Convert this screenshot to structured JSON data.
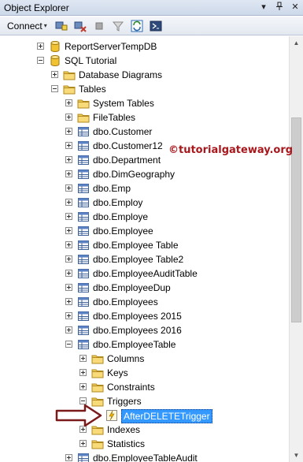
{
  "window": {
    "title": "Object Explorer",
    "controls": [
      "▾",
      "📌",
      "✕"
    ]
  },
  "toolbar": {
    "connect_label": "Connect",
    "connect_dropdown": "▾",
    "buttons": [
      "connect-icon",
      "disconnect-icon",
      "stop-icon",
      "filter-icon",
      "refresh-icon",
      "start-powershell-icon"
    ]
  },
  "tree": {
    "nodes": [
      {
        "label": "ReportServerTempDB",
        "icon": "database-icon",
        "expander": "plus"
      },
      {
        "label": "SQL Tutorial",
        "icon": "database-icon",
        "expander": "minus"
      },
      {
        "label": "Database Diagrams",
        "icon": "folder-icon",
        "expander": "plus"
      },
      {
        "label": "Tables",
        "icon": "folder-icon",
        "expander": "minus"
      },
      {
        "label": "System Tables",
        "icon": "folder-icon",
        "expander": "plus"
      },
      {
        "label": "FileTables",
        "icon": "folder-icon",
        "expander": "plus"
      },
      {
        "label": "dbo.Customer",
        "icon": "table-icon",
        "expander": "plus"
      },
      {
        "label": "dbo.Customer12",
        "icon": "table-icon",
        "expander": "plus"
      },
      {
        "label": "dbo.Department",
        "icon": "table-icon",
        "expander": "plus"
      },
      {
        "label": "dbo.DimGeography",
        "icon": "table-icon",
        "expander": "plus"
      },
      {
        "label": "dbo.Emp",
        "icon": "table-icon",
        "expander": "plus"
      },
      {
        "label": "dbo.Employ",
        "icon": "table-icon",
        "expander": "plus"
      },
      {
        "label": "dbo.Employe",
        "icon": "table-icon",
        "expander": "plus"
      },
      {
        "label": "dbo.Employee",
        "icon": "table-icon",
        "expander": "plus"
      },
      {
        "label": "dbo.Employee Table",
        "icon": "table-icon",
        "expander": "plus"
      },
      {
        "label": "dbo.Employee Table2",
        "icon": "table-icon",
        "expander": "plus"
      },
      {
        "label": "dbo.EmployeeAuditTable",
        "icon": "table-icon",
        "expander": "plus"
      },
      {
        "label": "dbo.EmployeeDup",
        "icon": "table-icon",
        "expander": "plus"
      },
      {
        "label": "dbo.Employees",
        "icon": "table-icon",
        "expander": "plus"
      },
      {
        "label": "dbo.Employees 2015",
        "icon": "table-icon",
        "expander": "plus"
      },
      {
        "label": "dbo.Employees 2016",
        "icon": "table-icon",
        "expander": "plus"
      },
      {
        "label": "dbo.EmployeeTable",
        "icon": "table-icon",
        "expander": "minus"
      },
      {
        "label": "Columns",
        "icon": "folder-icon",
        "expander": "plus"
      },
      {
        "label": "Keys",
        "icon": "folder-icon",
        "expander": "plus"
      },
      {
        "label": "Constraints",
        "icon": "folder-icon",
        "expander": "plus"
      },
      {
        "label": "Triggers",
        "icon": "folder-icon",
        "expander": "minus"
      },
      {
        "label": "AfterDELETETrigger",
        "icon": "trigger-icon",
        "expander": "none",
        "selected": true
      },
      {
        "label": "Indexes",
        "icon": "folder-icon",
        "expander": "plus"
      },
      {
        "label": "Statistics",
        "icon": "folder-icon",
        "expander": "plus"
      },
      {
        "label": "dbo.EmployeeTableAudit",
        "icon": "table-icon",
        "expander": "plus"
      }
    ]
  },
  "watermark": "©tutorialgateway.org",
  "colors": {
    "selection": "#3399ff",
    "watermark": "#a8171c",
    "arrow": "#7a1a1a"
  }
}
